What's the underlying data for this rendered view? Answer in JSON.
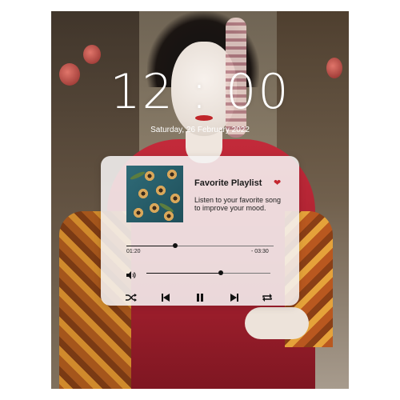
{
  "lockscreen": {
    "time": "12 : 00",
    "date": "Saturday, 26 February 2022"
  },
  "player": {
    "playlist_title": "Favorite Playlist",
    "description": "Listen to your favorite song to improve your mood.",
    "elapsed": "01:20",
    "remaining": "- 03:30",
    "progress": 0.33,
    "volume": 0.6,
    "colors": {
      "heart": "#c3262e",
      "text": "#1a1a1a"
    },
    "icons": {
      "heart": "heart-icon",
      "volume": "volume-icon",
      "shuffle": "shuffle-icon",
      "previous": "previous-icon",
      "pause": "pause-icon",
      "next": "next-icon",
      "repeat": "repeat-icon"
    }
  }
}
